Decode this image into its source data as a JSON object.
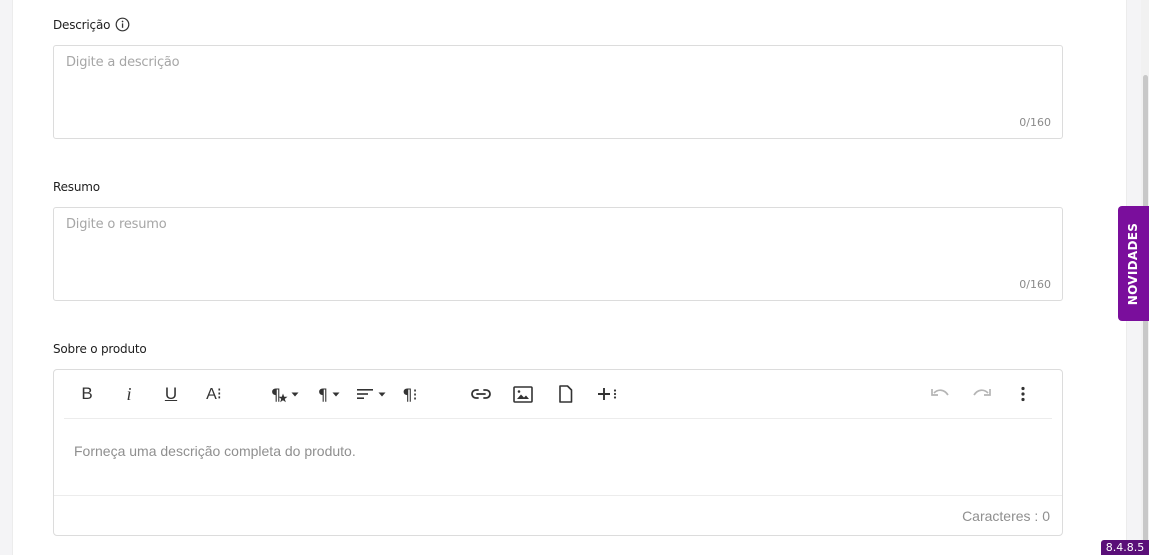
{
  "descricao": {
    "label": "Descrição",
    "placeholder": "Digite a descrição",
    "counter": "0/160"
  },
  "resumo": {
    "label": "Resumo",
    "placeholder": "Digite o resumo",
    "counter": "0/160"
  },
  "sobre": {
    "label": "Sobre o produto",
    "placeholder": "Forneça uma descrição completa do produto.",
    "char_count": "Caracteres : 0",
    "toolbar": {
      "bold": "B",
      "italic": "i",
      "underline": "U",
      "font_size": "A⁝",
      "para_style": "¶",
      "paragraph": "¶",
      "para_more": "¶⁝"
    }
  },
  "side_tab": "NOVIDADES",
  "version": "8.4.8.5",
  "colors": {
    "accent": "#7a0e9c",
    "border": "#dcdcdc",
    "placeholder": "#a6a6a6"
  }
}
